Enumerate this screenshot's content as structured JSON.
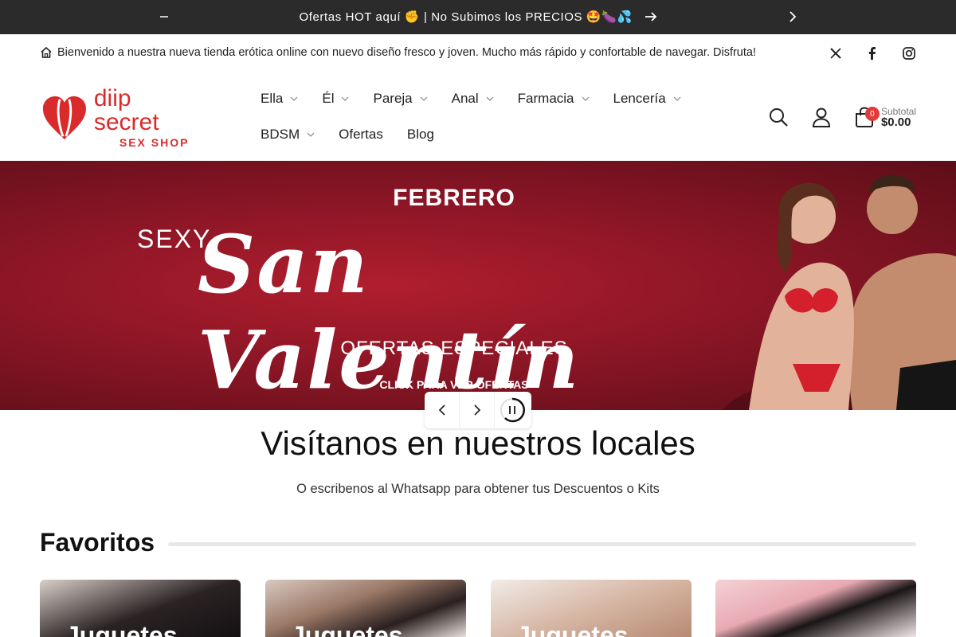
{
  "announcement": {
    "message": "Ofertas HOT aquí ✊ | No Subimos los PRECIOS 🤩🍆💦",
    "prev_icon": "minus-icon",
    "next_icon": "chevron-right-icon"
  },
  "welcome": {
    "text": "Bienvenido a nuestra nueva tienda erótica online con nuevo diseño fresco y joven. Mucho más rápido y confortable de navegar. Disfruta!",
    "social": [
      "x-icon",
      "facebook-icon",
      "instagram-icon"
    ]
  },
  "logo": {
    "name": "diip secret",
    "sub": "SEX SHOP",
    "color": "#d92b2b"
  },
  "nav": {
    "row1": [
      {
        "label": "Ella",
        "dropdown": true
      },
      {
        "label": "Él",
        "dropdown": true
      },
      {
        "label": "Pareja",
        "dropdown": true
      },
      {
        "label": "Anal",
        "dropdown": true
      },
      {
        "label": "Farmacia",
        "dropdown": true
      },
      {
        "label": "Lencería",
        "dropdown": true
      }
    ],
    "row2": [
      {
        "label": "BDSM",
        "dropdown": true
      },
      {
        "label": "Ofertas",
        "dropdown": false
      },
      {
        "label": "Blog",
        "dropdown": false
      }
    ]
  },
  "cart": {
    "count": "0",
    "subtotal_label": "Subtotal",
    "subtotal_value": "$0.00"
  },
  "hero": {
    "top": "FEBRERO",
    "sexy": "SEXY",
    "title": "San Valentín",
    "subtitle": "OFERTAS ESPECIALES",
    "cta": "CLICK PARA VER OFERTAS"
  },
  "section": {
    "title": "Visítanos en nuestros locales",
    "subtitle": "O escribenos al Whatsapp para obtener tus Descuentos o Kits"
  },
  "favorites": {
    "title": "Favoritos",
    "cards": [
      {
        "label": "Juguetes"
      },
      {
        "label": "Juguetes"
      },
      {
        "label": "Juguetes"
      },
      {
        "label": ""
      }
    ]
  }
}
